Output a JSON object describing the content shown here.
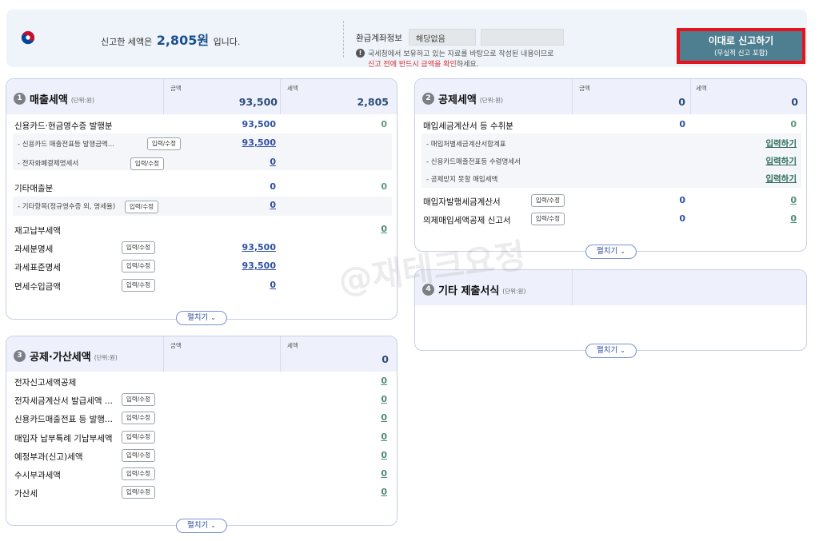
{
  "summary": {
    "prefix": "신고한 세액은",
    "amount": "2,805원",
    "suffix": "입니다."
  },
  "refund": {
    "label": "환급계좌정보",
    "value": "해당없음",
    "notice_line1": "국세청에서 보유하고 있는 자료를 바탕으로 작성된 내용이므로",
    "notice_line2_red": "신고 전에 반드시 금액을 확인",
    "notice_line2_rest": "하세요."
  },
  "submit": {
    "label": "이대로 신고하기",
    "sublabel": "(무실적 신고 포함)"
  },
  "common": {
    "amount_header": "금액",
    "tax_header": "세액",
    "unit": "(단위:원)",
    "edit": "입력/수정",
    "input": "입력하기",
    "expand": "펼치기",
    "chevron": "⌄"
  },
  "sales": {
    "num": "1",
    "title": "매출세액",
    "amount_total": "93,500",
    "tax_total": "2,805",
    "card_issued": {
      "label": "신용카드·현금영수증 발행분",
      "amount": "93,500",
      "tax": "0"
    },
    "card_sub1": {
      "label": "- 신용카드 매출전표등 발행금액...",
      "amount": "93,500"
    },
    "card_sub2": {
      "label": "- 전자화폐결제명세서",
      "amount": "0"
    },
    "other_sales": {
      "label": "기타매출분",
      "amount": "0",
      "tax": "0"
    },
    "other_sub1": {
      "label": "- 기타항목(정규영수증 외, 영세율)",
      "amount": "0"
    },
    "inventory": {
      "label": "재고납부세액",
      "tax": "0"
    },
    "taxable_detail": {
      "label": "과세분명세",
      "amount": "93,500"
    },
    "taxable_standard": {
      "label": "과세표준명세",
      "amount": "93,500"
    },
    "exempt_income": {
      "label": "면세수입금액",
      "amount": "0"
    }
  },
  "deduction": {
    "num": "2",
    "title": "공제세액",
    "amount_total": "0",
    "tax_total": "0",
    "purchase_invoice": {
      "label": "매입세금계산서 등 수취분",
      "amount": "0",
      "tax": "0"
    },
    "sub1": {
      "label": "- 매입처별세금계산서합계표"
    },
    "sub2": {
      "label": "- 신용카드매출전표등 수령명세서"
    },
    "sub3": {
      "label": "- 공제받지 못할 매입세액"
    },
    "buyer_issued": {
      "label": "매입자발행세금계산서",
      "amount": "0",
      "tax": "0"
    },
    "deemed_input": {
      "label": "의제매입세액공제 신고서",
      "amount": "0",
      "tax": "0"
    }
  },
  "other_forms": {
    "num": "4",
    "title": "기타 제출서식"
  },
  "adjustment": {
    "num": "3",
    "title": "공제·가산세액",
    "tax_total": "0",
    "rows": [
      {
        "label": "전자신고세액공제",
        "tax": "0",
        "edit": false
      },
      {
        "label": "전자세금계산서 발급세액 ...",
        "tax": "0",
        "edit": true
      },
      {
        "label": "신용카드매출전표 등 발행...",
        "tax": "0",
        "edit": true
      },
      {
        "label": "매입자 납부특례 기납부세액",
        "tax": "0",
        "edit": true
      },
      {
        "label": "예정부과(신고)세액",
        "tax": "0",
        "edit": true
      },
      {
        "label": "수시부과세액",
        "tax": "0",
        "edit": true
      },
      {
        "label": "가산세",
        "tax": "0",
        "edit": true
      }
    ]
  },
  "watermark": "@재테크요정",
  "colors": {
    "accent_blue": "#1c4f91",
    "submit_bg": "#4e7f90",
    "highlight_red": "#e8121d",
    "link_green": "#2f6d5a"
  }
}
